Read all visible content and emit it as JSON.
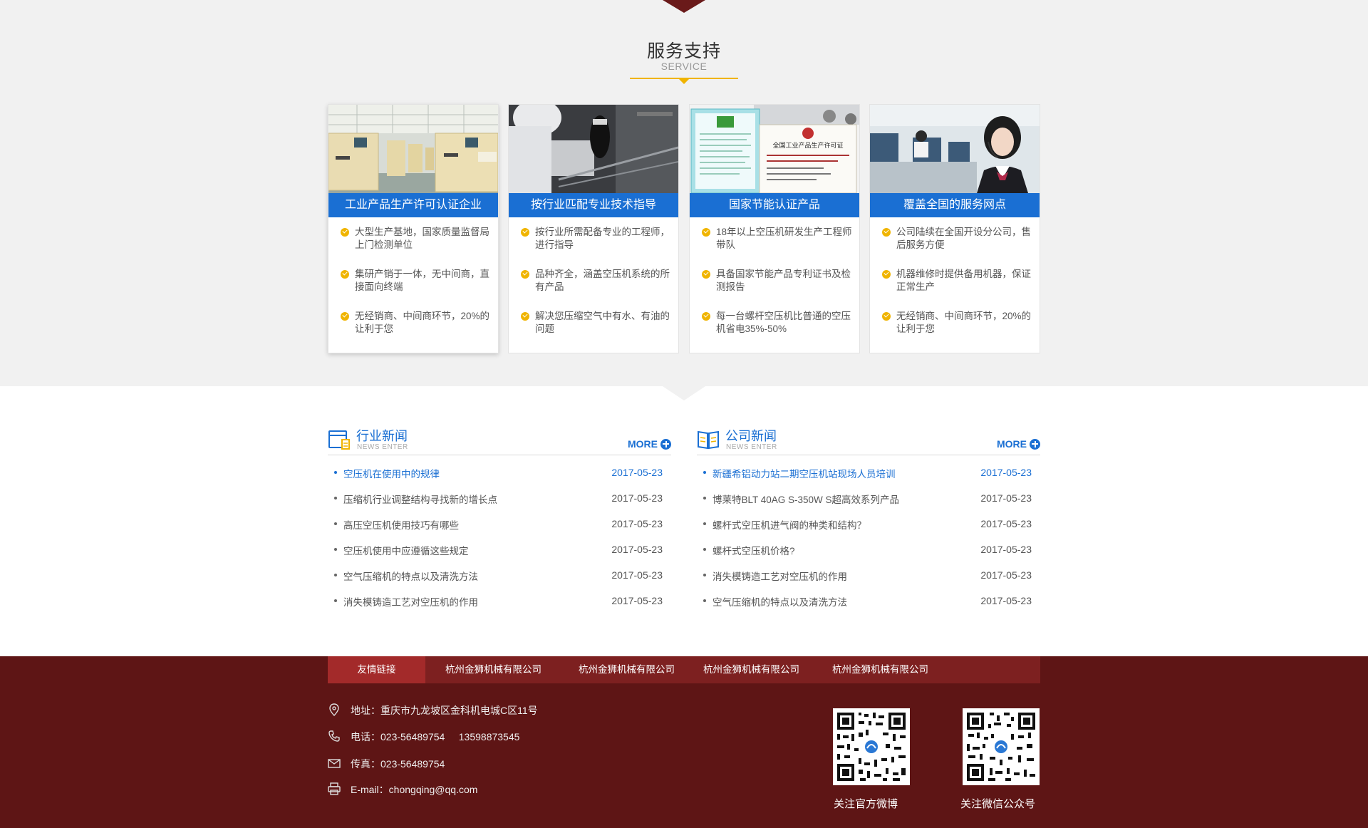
{
  "service": {
    "title": "服务支持",
    "subtitle": "SERVICE",
    "cards": [
      {
        "caption": "工业产品生产许可认证企业",
        "points": [
          "大型生产基地，国家质量监督局上门检测单位",
          "集研产销于一体，无中间商，直接面向终端",
          "无经销商、中间商环节，20%的让利于您"
        ]
      },
      {
        "caption": "按行业匹配专业技术指导",
        "points": [
          "按行业所需配备专业的工程师，进行指导",
          "品种齐全，涵盖空压机系统的所有产品",
          "解决您压缩空气中有水、有油的问题"
        ]
      },
      {
        "caption": "国家节能认证产品",
        "points": [
          "18年以上空压机研发生产工程师带队",
          "具备国家节能产品专利证书及检测报告",
          "每一台螺杆空压机比普通的空压机省电35%-50%"
        ]
      },
      {
        "caption": "覆盖全国的服务网点",
        "points": [
          "公司陆续在全国开设分公司，售后服务方便",
          "机器维修时提供备用机器，保证正常生产",
          "无经销商、中间商环节，20%的让利于您"
        ]
      }
    ],
    "cert_text": "全国工业产品生产许可证"
  },
  "industry_news": {
    "title": "行业新闻",
    "subtitle": "NEWS  ENTER",
    "more": "MORE",
    "items": [
      {
        "title": "空压机在使用中的规律",
        "date": "2017-05-23"
      },
      {
        "title": "压缩机行业调整结构寻找新的增长点",
        "date": "2017-05-23"
      },
      {
        "title": "高压空压机使用技巧有哪些",
        "date": "2017-05-23"
      },
      {
        "title": "空压机使用中应遵循这些规定",
        "date": "2017-05-23"
      },
      {
        "title": "空气压缩机的特点以及清洗方法",
        "date": "2017-05-23"
      },
      {
        "title": "消失模铸造工艺对空压机的作用",
        "date": "2017-05-23"
      }
    ]
  },
  "company_news": {
    "title": "公司新闻",
    "subtitle": "NEWS  ENTER",
    "more": "MORE",
    "items": [
      {
        "title": "新疆希铝动力站二期空压机站现场人员培训",
        "date": "2017-05-23"
      },
      {
        "title": "博莱特BLT 40AG S-350W S超高效系列产品",
        "date": "2017-05-23"
      },
      {
        "title": "螺杆式空压机进气阀的种类和结构？",
        "date": "2017-05-23"
      },
      {
        "title": "螺杆式空压机价格?",
        "date": "2017-05-23"
      },
      {
        "title": "消失模铸造工艺对空压机的作用",
        "date": "2017-05-23"
      },
      {
        "title": "空气压缩机的特点以及清洗方法",
        "date": "2017-05-23"
      }
    ]
  },
  "footer": {
    "links_label": "友情链接",
    "links": [
      "杭州金狮机械有限公司",
      "杭州金狮机械有限公司",
      "杭州金狮机械有限公司",
      "杭州金狮机械有限公司"
    ],
    "address": "地址：重庆市九龙坡区金科机电城C区11号",
    "phone": "电话：023-56489754     13598873545",
    "fax": "传真：023-56489754",
    "email": "E-mail：chongqing@qq.com",
    "qr1_caption": "关注官方微博",
    "qr2_caption": "关注微信公众号"
  },
  "colors": {
    "accent_blue": "#1a6fd3",
    "gold": "#f0b400",
    "footer_bg": "#5e1515",
    "links_bar": "#7d2020",
    "links_label": "#a32a2a"
  }
}
